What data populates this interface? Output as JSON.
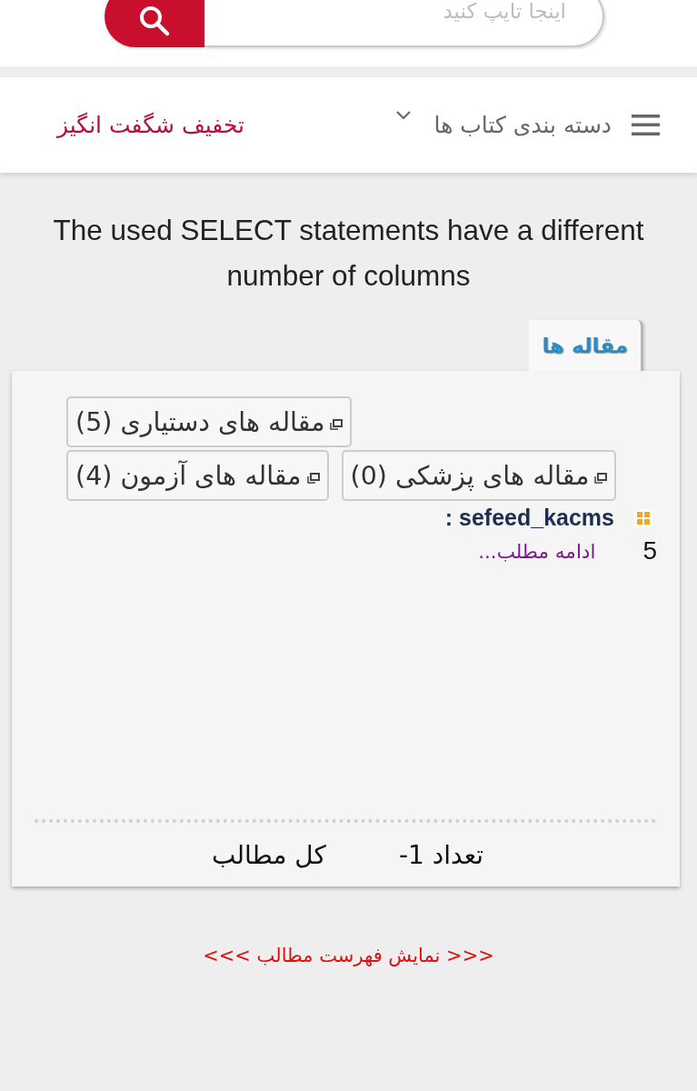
{
  "search": {
    "placeholder": "اینجا تایپ کنید"
  },
  "nav": {
    "menu_label": "دسته بندی کتاب ها",
    "promo": "تخفیف شگفت انگیز"
  },
  "message": "The used SELECT statements have a different number of columns",
  "tabs": [
    {
      "label": "مقاله ها",
      "selected": true
    }
  ],
  "categories": [
    [
      "مقاله های دستیاری (5)"
    ],
    [
      "مقاله های پزشکی (0)",
      "مقاله های آزمون (4)"
    ]
  ],
  "entry": {
    "author": ": sefeed_kacms",
    "number": "5",
    "read_more": "ادامه مطلب..."
  },
  "footer": {
    "count": "تعداد 1-",
    "total": "کل مطالب"
  },
  "list_link": "<<< نمایش فهرست مطالب >>>"
}
